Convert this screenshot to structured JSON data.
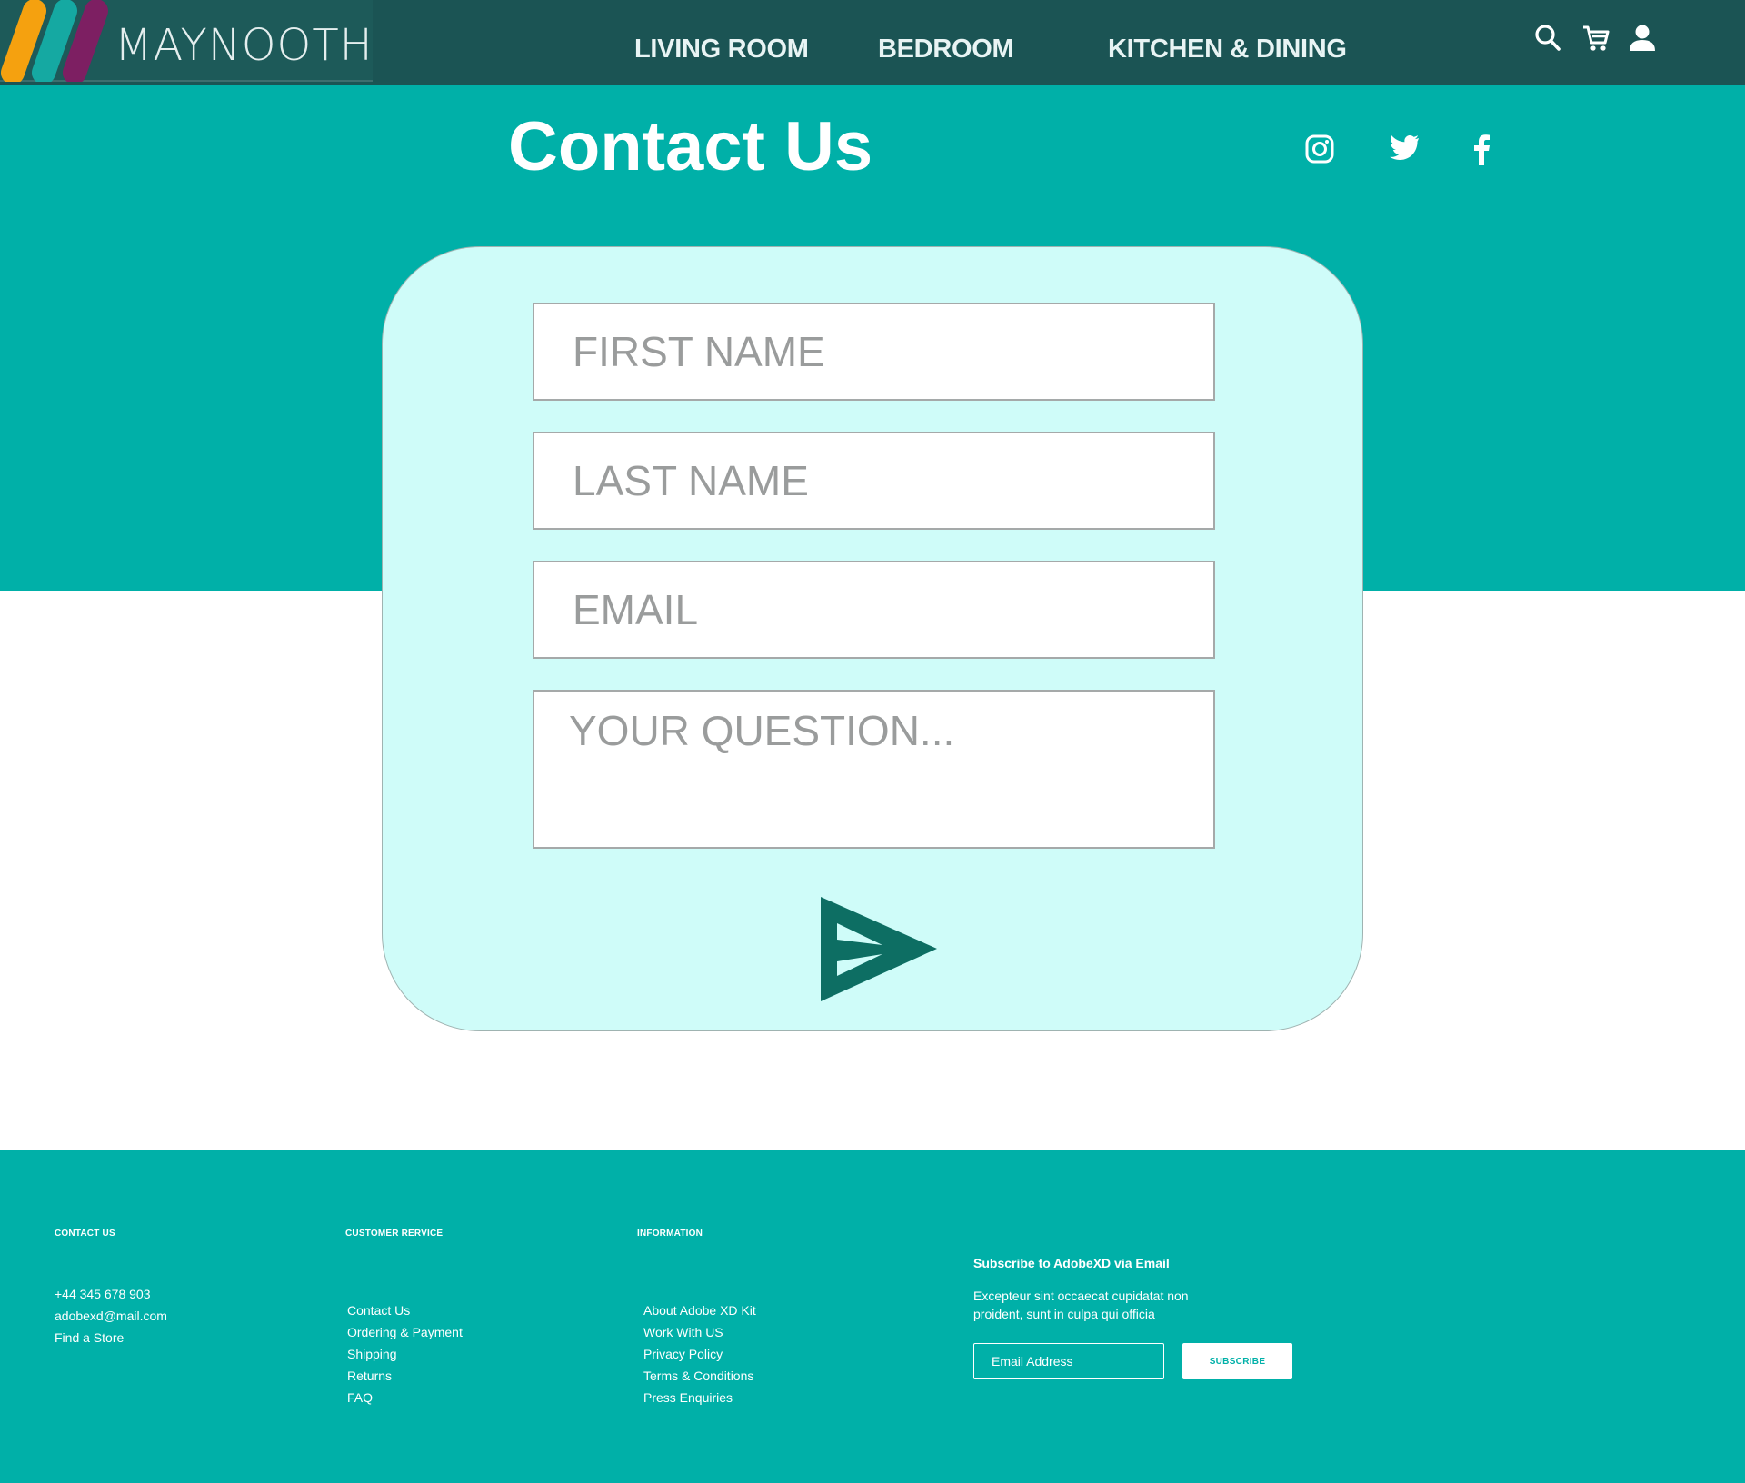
{
  "brand": {
    "name": "MAYNOOTH",
    "logo_colors": [
      "#f5a10f",
      "#15a9a2",
      "#7d1f62"
    ]
  },
  "nav": {
    "items": [
      {
        "label": "LIVING ROOM"
      },
      {
        "label": "BEDROOM"
      },
      {
        "label": "KITCHEN & DINING"
      }
    ],
    "icons": [
      "search-icon",
      "cart-icon",
      "user-icon"
    ]
  },
  "page": {
    "title": "Contact Us"
  },
  "social": [
    "instagram-icon",
    "twitter-icon",
    "facebook-icon"
  ],
  "form": {
    "first_name": {
      "placeholder": "FIRST NAME",
      "value": ""
    },
    "last_name": {
      "placeholder": "LAST NAME",
      "value": ""
    },
    "email": {
      "placeholder": "EMAIL",
      "value": ""
    },
    "question": {
      "placeholder": "YOUR QUESTION...",
      "value": ""
    },
    "submit_icon": "send-icon"
  },
  "footer": {
    "contact": {
      "heading": "CONTACT US",
      "items": [
        "+44 345 678 903",
        "adobexd@mail.com",
        "Find a Store"
      ]
    },
    "customer_service": {
      "heading": "CUSTOMER RERVICE",
      "items": [
        "Contact Us",
        "Ordering & Payment",
        "Shipping",
        "Returns",
        "FAQ"
      ]
    },
    "information": {
      "heading": "INFORMATION",
      "items": [
        "About Adobe XD Kit",
        "Work With US",
        "Privacy Policy",
        "Terms & Conditions",
        "Press Enquiries"
      ]
    },
    "subscribe": {
      "title": "Subscribe to AdobeXD via Email",
      "description": "Excepteur sint occaecat cupidatat non proident, sunt in culpa qui officia",
      "input_placeholder": "Email Address",
      "button_label": "SUBSCRIBE"
    }
  },
  "colors": {
    "header_bg": "#1b5454",
    "teal": "#00b0a8",
    "card_bg": "#cffcf9",
    "send_icon": "#0d6e63"
  }
}
